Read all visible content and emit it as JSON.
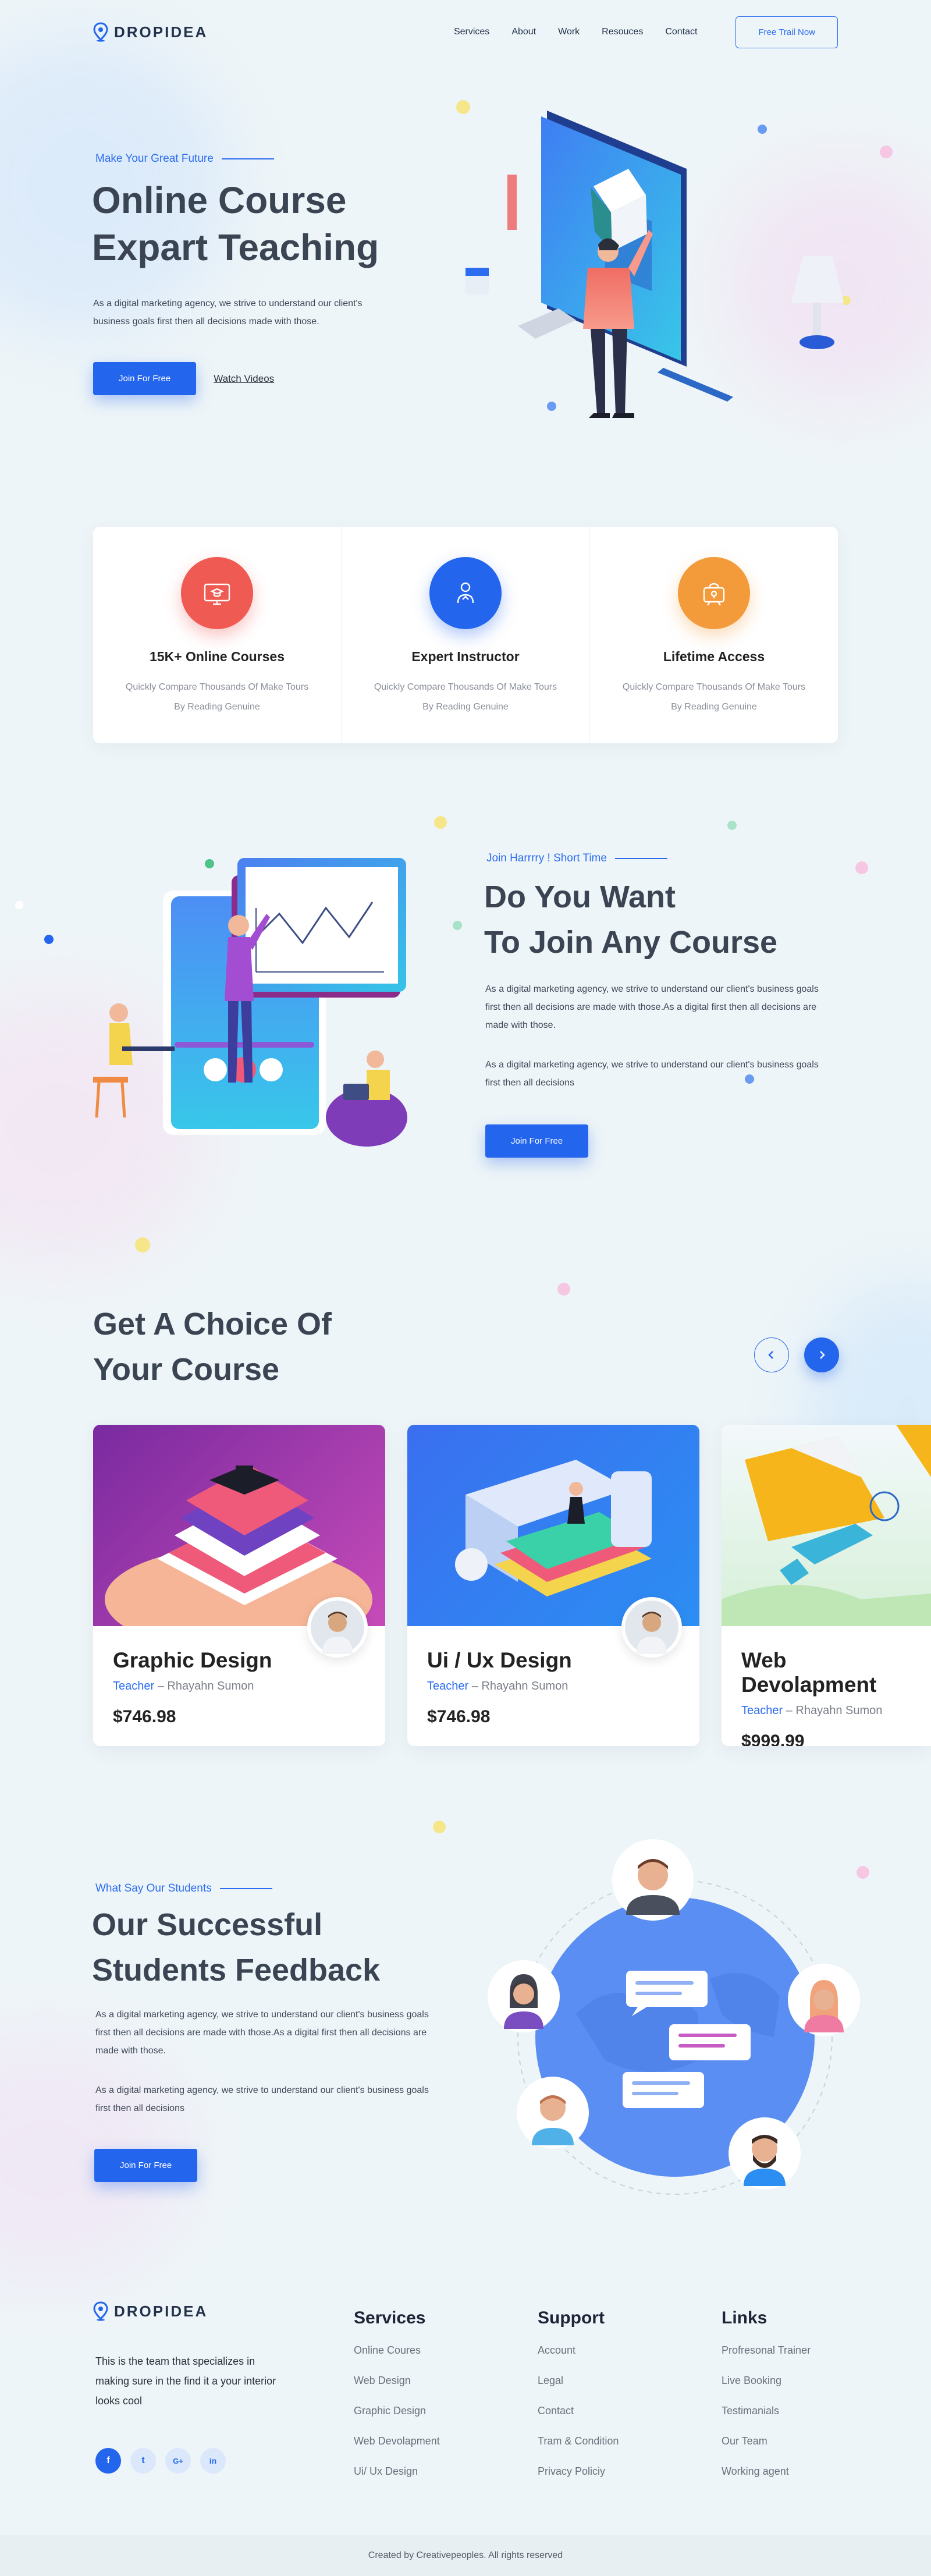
{
  "brand": {
    "name": "DROPIDEA",
    "accent": "#2465ee"
  },
  "nav": {
    "links": [
      "Services",
      "About",
      "Work",
      "Resouces",
      "Contact"
    ],
    "cta": "Free Trail Now"
  },
  "hero": {
    "eyebrow": "Make Your Great Future",
    "title_line1": "Online Course",
    "title_line2": "Expart Teaching",
    "desc_line1": "As a digital marketing agency, we strive to understand our client's",
    "desc_line2": "business goals first then all decisions  made with those.",
    "primary_btn": "Join For Free",
    "secondary_link": "Watch Videos"
  },
  "features": [
    {
      "icon": "monitor-graduation-icon",
      "color": "#ef5a52",
      "title": "15K+ Online Courses",
      "desc": "Quickly Compare Thousands Of Make Tours By Reading Genuine"
    },
    {
      "icon": "instructor-icon",
      "color": "#2465ee",
      "title": "Expert Instructor",
      "desc": "Quickly Compare Thousands Of Make Tours By Reading Genuine"
    },
    {
      "icon": "lifetime-access-icon",
      "color": "#f39a3a",
      "title": "Lifetime Access",
      "desc": "Quickly Compare Thousands Of Make Tours By Reading Genuine"
    }
  ],
  "join": {
    "eyebrow": "Join Harrrry !  Short Time",
    "title_line1": "Do You Want",
    "title_line2": "To Join Any Course",
    "para1": "As a digital marketing agency, we strive to understand our client's business goals first then all decisions are made with those.As a digital  first then all decisions are made with those.",
    "para2": "As a digital marketing agency, we strive to understand our client's business goals first then all decisions",
    "btn": "Join For Free"
  },
  "courses": {
    "title_line1": "Get A Choice Of",
    "title_line2": "Your Course",
    "teacher_label": "Teacher",
    "items": [
      {
        "title": "Graphic Design",
        "teacher": "Rhayahn Sumon",
        "price": "$746.98"
      },
      {
        "title": "Ui / Ux Design",
        "teacher": "Rhayahn Sumon",
        "price": "$746.98"
      },
      {
        "title": "Web Devolapment",
        "teacher": "Rhayahn Sumon",
        "price": "$999.99"
      }
    ]
  },
  "feedback": {
    "eyebrow": "What Say Our Students",
    "title_line1": "Our Successful",
    "title_line2": "Students Feedback",
    "para1": "As a digital marketing agency, we strive to understand our client's business goals first then all decisions are made with those.As a digital  first then all decisions are made with those.",
    "para2": "As a digital marketing agency, we strive to understand our client's business goals first then all decisions",
    "btn": "Join For Free"
  },
  "footer": {
    "about": "This is the team that specializes in making sure  in the find it a your interior looks cool",
    "social": [
      "f",
      "t",
      "G+",
      "in"
    ],
    "columns": [
      {
        "title": "Services",
        "links": [
          "Online Coures",
          "Web Design",
          "Graphic Design",
          "Web Devolapment",
          "Ui/ Ux Design"
        ]
      },
      {
        "title": "Support",
        "links": [
          "Account",
          "Legal",
          "Contact",
          "Tram & Condition",
          "Privacy Policiy"
        ]
      },
      {
        "title": "Links",
        "links": [
          "Profresonal Trainer",
          "Live Booking",
          "Testimanials",
          "Our Team",
          "Working agent"
        ]
      }
    ],
    "copyright": "Created by Creativepeoples. All rights reserved"
  }
}
